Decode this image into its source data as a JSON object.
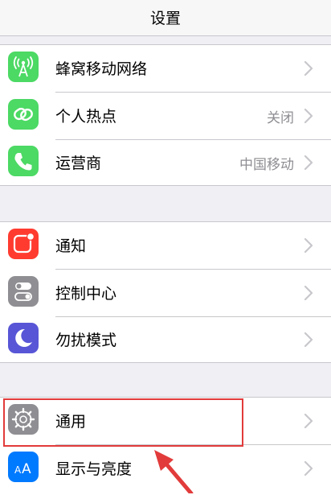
{
  "nav": {
    "title": "设置"
  },
  "group1": [
    {
      "label": "蜂窝移动网络",
      "value": "",
      "icon": "cellular-antenna-icon",
      "color": "#4cd964"
    },
    {
      "label": "个人热点",
      "value": "关闭",
      "icon": "hotspot-link-icon",
      "color": "#4cd964"
    },
    {
      "label": "运营商",
      "value": "中国移动",
      "icon": "phone-icon",
      "color": "#4cd964"
    }
  ],
  "group2": [
    {
      "label": "通知",
      "value": "",
      "icon": "notifications-icon",
      "color": "#ff3b30"
    },
    {
      "label": "控制中心",
      "value": "",
      "icon": "control-center-toggles-icon",
      "color": "#8e8e93"
    },
    {
      "label": "勿扰模式",
      "value": "",
      "icon": "moon-icon",
      "color": "#5856d6"
    }
  ],
  "group3": [
    {
      "label": "通用",
      "value": "",
      "icon": "gear-icon",
      "color": "#8e8e93"
    },
    {
      "label": "显示与亮度",
      "value": "",
      "icon": "display-brightness-icon",
      "color": "#007aff"
    }
  ],
  "annotation": {
    "highlight_color": "#e23b3b"
  }
}
